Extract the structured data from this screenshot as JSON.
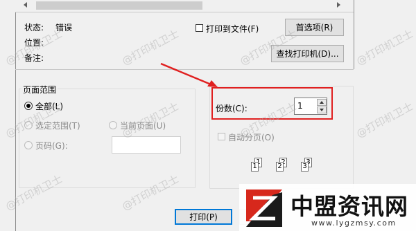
{
  "status": {
    "label_status": "状态:",
    "value_status": "错误",
    "label_location": "位置:",
    "label_comment": "备注:"
  },
  "print_to_file_label": "打印到文件(F)",
  "preferences_button": "首选项(R)",
  "find_printer_button": "查找打印机(D)...",
  "page_range": {
    "legend": "页面范围",
    "all": "全部(L)",
    "selection": "选定范围(T)",
    "current_page": "当前页面(U)",
    "pages": "页码(G):"
  },
  "copies": {
    "label": "份数(C):",
    "value": "1",
    "collate": "自动分页(O)",
    "collate_pages": [
      "1",
      "1",
      "2",
      "2",
      "3",
      "3"
    ]
  },
  "print_button": "打印(P)",
  "watermark_text": "@打印机卫士",
  "logo": {
    "name": "中盟资讯网",
    "url": "www.lygzmsy.com",
    "colors": {
      "primary": "#d7281c",
      "dark": "#1a1a1a"
    }
  },
  "colors": {
    "highlight_box": "#e02020",
    "arrow": "#e02020",
    "default_button_border": "#0078d7"
  }
}
